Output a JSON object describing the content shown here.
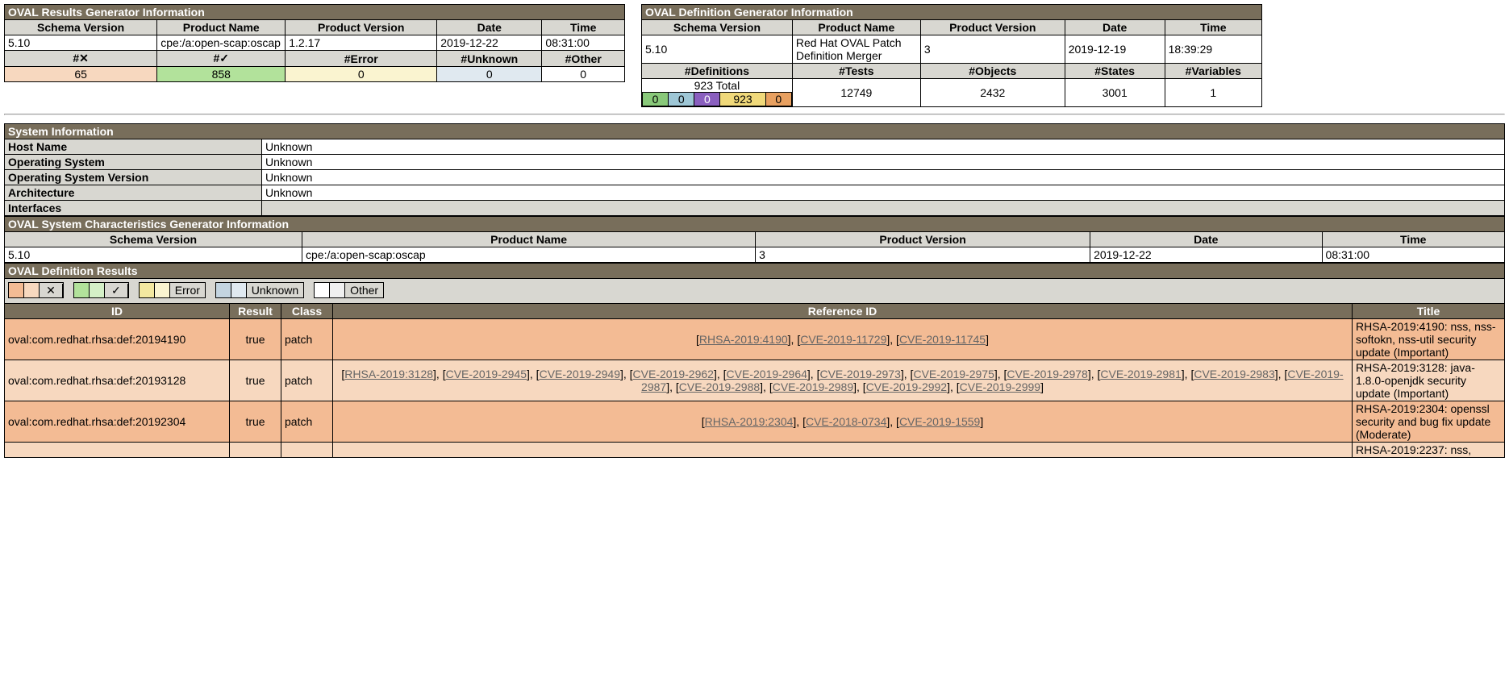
{
  "results_gen": {
    "title": "OVAL Results Generator Information",
    "headers": {
      "schema": "Schema Version",
      "pname": "Product Name",
      "pver": "Product Version",
      "date": "Date",
      "time": "Time"
    },
    "schema": "5.10",
    "pname": "cpe:/a:open-scap:oscap",
    "pver": "1.2.17",
    "date": "2019-12-22",
    "time": "08:31:00",
    "count_headers": {
      "x": "#✕",
      "chk": "#✓",
      "err": "#Error",
      "unk": "#Unknown",
      "oth": "#Other"
    },
    "counts": {
      "x": "65",
      "chk": "858",
      "err": "0",
      "unk": "0",
      "oth": "0"
    }
  },
  "def_gen": {
    "title": "OVAL Definition Generator Information",
    "headers": {
      "schema": "Schema Version",
      "pname": "Product Name",
      "pver": "Product Version",
      "date": "Date",
      "time": "Time"
    },
    "schema": "5.10",
    "pname": "Red Hat OVAL Patch Definition Merger",
    "pver": "3",
    "date": "2019-12-19",
    "time": "18:39:29",
    "block_headers": {
      "defs": "#Definitions",
      "tests": "#Tests",
      "objs": "#Objects",
      "states": "#States",
      "vars": "#Variables"
    },
    "total_label": "923 Total",
    "chips": {
      "g": "0",
      "b": "0",
      "p": "0",
      "y": "923",
      "o": "0"
    },
    "tests": "12749",
    "objs": "2432",
    "states": "3001",
    "vars": "1"
  },
  "sysinfo": {
    "title": "System Information",
    "rows": {
      "host_l": "Host Name",
      "host_v": "Unknown",
      "os_l": "Operating System",
      "os_v": "Unknown",
      "osv_l": "Operating System Version",
      "osv_v": "Unknown",
      "arch_l": "Architecture",
      "arch_v": "Unknown",
      "if_l": "Interfaces",
      "if_v": ""
    }
  },
  "syschar": {
    "title": "OVAL System Characteristics Generator Information",
    "headers": {
      "schema": "Schema Version",
      "pname": "Product Name",
      "pver": "Product Version",
      "date": "Date",
      "time": "Time"
    },
    "schema": "5.10",
    "pname": "cpe:/a:open-scap:oscap",
    "pver": "3",
    "date": "2019-12-22",
    "time": "08:31:00"
  },
  "results": {
    "title": "OVAL Definition Results",
    "legend": {
      "x": "✕",
      "chk": "✓",
      "err": "Error",
      "unk": "Unknown",
      "oth": "Other"
    },
    "headers": {
      "id": "ID",
      "result": "Result",
      "class": "Class",
      "ref": "Reference ID",
      "ttl": "Title"
    },
    "rows": [
      {
        "id": "oval:com.redhat.rhsa:def:20194190",
        "result": "true",
        "class": "patch",
        "refs": [
          "RHSA-2019:4190",
          "CVE-2019-11729",
          "CVE-2019-11745"
        ],
        "title": "RHSA-2019:4190: nss, nss-softokn, nss-util security update (Important)"
      },
      {
        "id": "oval:com.redhat.rhsa:def:20193128",
        "result": "true",
        "class": "patch",
        "refs": [
          "RHSA-2019:3128",
          "CVE-2019-2945",
          "CVE-2019-2949",
          "CVE-2019-2962",
          "CVE-2019-2964",
          "CVE-2019-2973",
          "CVE-2019-2975",
          "CVE-2019-2978",
          "CVE-2019-2981",
          "CVE-2019-2983",
          "CVE-2019-2987",
          "CVE-2019-2988",
          "CVE-2019-2989",
          "CVE-2019-2992",
          "CVE-2019-2999"
        ],
        "title": "RHSA-2019:3128: java-1.8.0-openjdk security update (Important)"
      },
      {
        "id": "oval:com.redhat.rhsa:def:20192304",
        "result": "true",
        "class": "patch",
        "refs": [
          "RHSA-2019:2304",
          "CVE-2018-0734",
          "CVE-2019-1559"
        ],
        "title": "RHSA-2019:2304: openssl security and bug fix update (Moderate)"
      },
      {
        "id": "",
        "result": "",
        "class": "",
        "refs": [],
        "title": "RHSA-2019:2237: nss,"
      }
    ]
  }
}
